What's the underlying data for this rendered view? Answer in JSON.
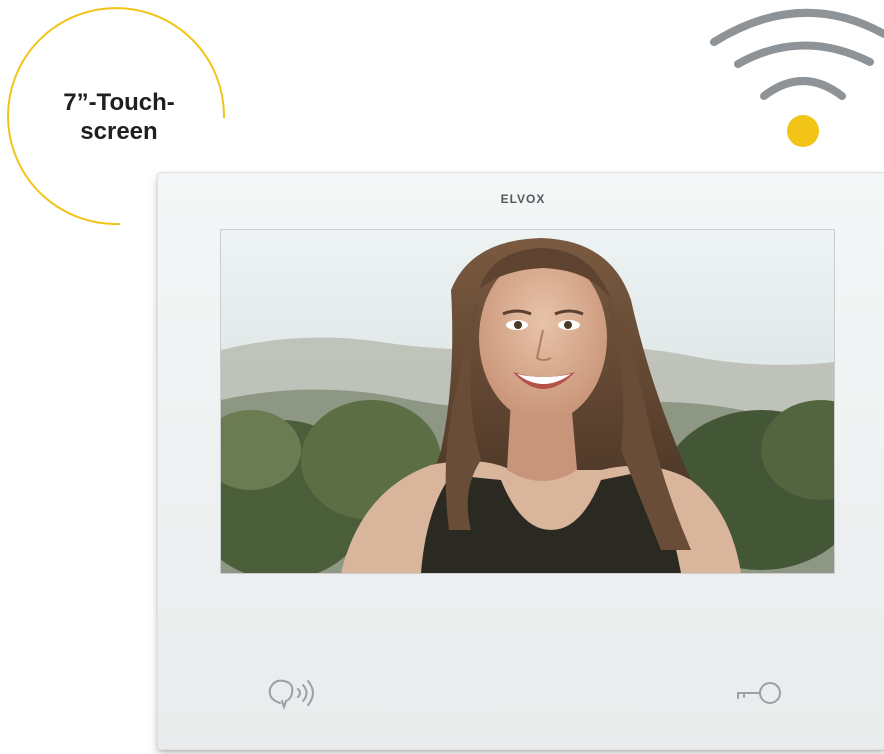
{
  "callout": {
    "line1": "7”-Touch-",
    "line2": "screen"
  },
  "device": {
    "brand": "ELVOX"
  },
  "colors": {
    "accent_yellow": "#f2c418",
    "wifi_gray": "#8e9397",
    "device_white": "#f2f4f5"
  },
  "icons": {
    "wifi": "wifi-icon",
    "talk": "speak-icon",
    "door": "key-icon"
  }
}
